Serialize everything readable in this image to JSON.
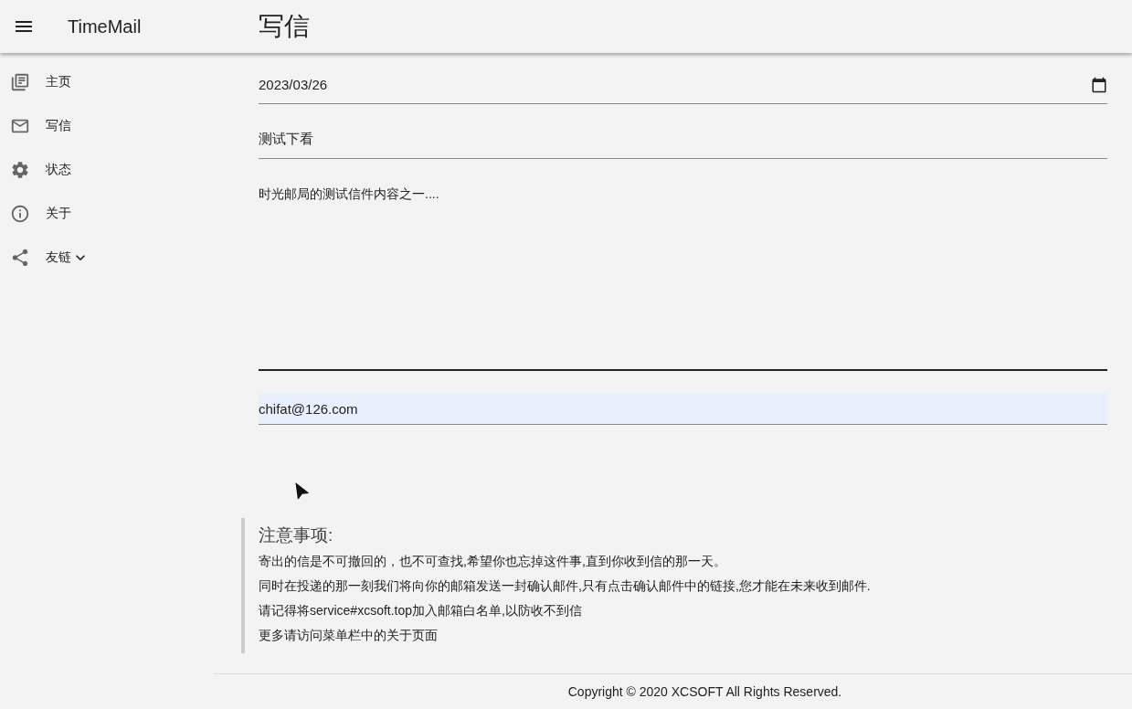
{
  "app_bar": {
    "brand": "TimeMail",
    "page_title": "写信"
  },
  "sidebar": {
    "items": [
      {
        "kind": "home",
        "label": "主页",
        "expandable": false
      },
      {
        "kind": "mail",
        "label": "写信",
        "expandable": false
      },
      {
        "kind": "settings",
        "label": "状态",
        "expandable": false
      },
      {
        "kind": "info",
        "label": "关于",
        "expandable": false
      },
      {
        "kind": "share",
        "label": "友链",
        "expandable": true
      }
    ]
  },
  "form": {
    "date": "2023/03/26",
    "subject": "测试下看",
    "content": "时光邮局的测试信件内容之一....",
    "email": "chifat@126.com"
  },
  "notes": {
    "title": "注意事项:",
    "lines": [
      "寄出的信是不可撤回的，也不可查找,希望你也忘掉这件事,直到你收到信的那一天。",
      "同时在投递的那一刻我们将向你的邮箱发送一封确认邮件,只有点击确认邮件中的链接,您才能在未来收到邮件.",
      "请记得将service#xcsoft.top加入邮箱白名单,以防收不到信",
      "更多请访问菜单栏中的关于页面"
    ]
  },
  "footer": "Copyright © 2020 XCSOFT All Rights Reserved."
}
